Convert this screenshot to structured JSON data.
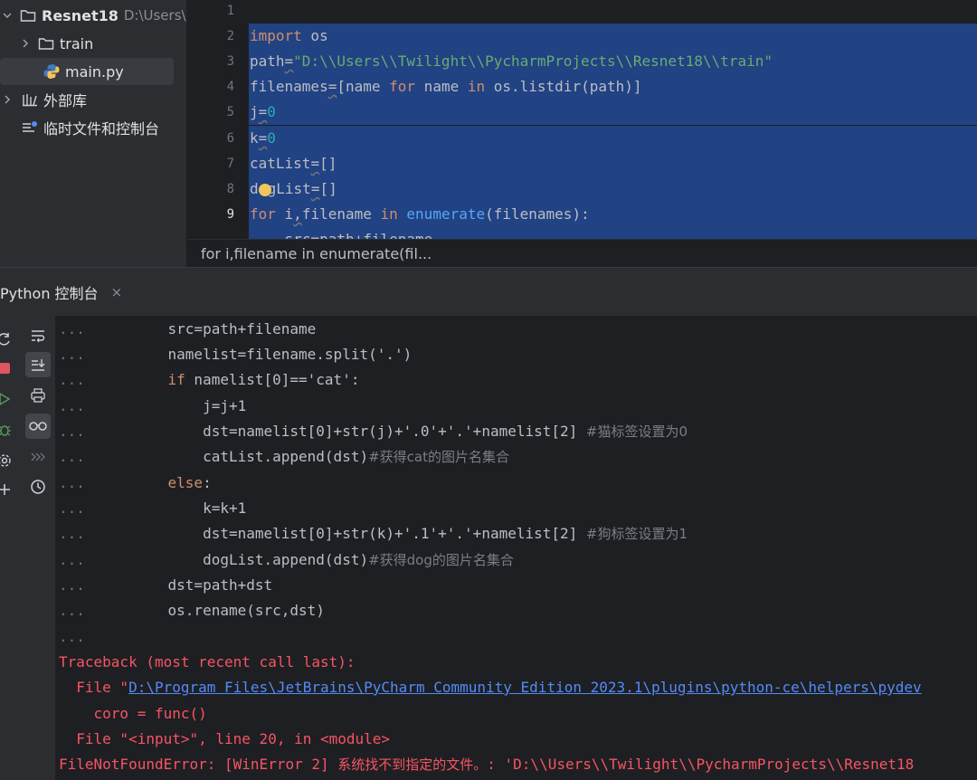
{
  "project_tree": {
    "root": {
      "name": "Resnet18",
      "path": "D:\\Users\\"
    },
    "items": [
      {
        "label": "train"
      },
      {
        "label": "main.py"
      },
      {
        "label": "外部库"
      },
      {
        "label": "临时文件和控制台"
      }
    ]
  },
  "editor": {
    "line_numbers": [
      "1",
      "2",
      "3",
      "4",
      "5",
      "6",
      "7",
      "8",
      "9"
    ],
    "current_line": "9",
    "lines": {
      "l2": {
        "kw_import": "import",
        "rest": " os"
      },
      "l3": {
        "name": "path",
        "eq": "=",
        "str": "\"D:\\\\Users\\\\Twilight\\\\PycharmProjects\\\\Resnet18\\\\train\""
      },
      "l4": {
        "name": "filenames",
        "eq": "=",
        "a": "[name ",
        "kw_for": "for",
        "b": " name ",
        "kw_in": "in",
        "c": " os.listdir(path)]"
      },
      "l5": {
        "name": "j",
        "eq": "=",
        "num": "0"
      },
      "l6": {
        "name": "k",
        "eq": "=",
        "num": "0"
      },
      "l7": {
        "name": "catList",
        "eq": "=",
        "rest": "[]"
      },
      "l8": {
        "a": "d",
        "b": "gList",
        "eq": "=",
        "rest": "[]"
      },
      "l9": {
        "kw_for": "for",
        "a": " i",
        "comma": ",",
        "b": "filename ",
        "kw_in": "in",
        "fn": " enumerate",
        "rest": "(filenames):"
      },
      "l10_partial": "    src=path+filename"
    }
  },
  "breadcrumb": {
    "text": "for i,filename in enumerate(fil..."
  },
  "console": {
    "tab_label": "Python 控制台",
    "tab_close": "×",
    "prompt": "...",
    "lines": [
      {
        "indent": "    ",
        "code": "src=path+filename"
      },
      {
        "indent": "    ",
        "code": "namelist=filename.split('.')"
      },
      {
        "indent": "    ",
        "kw": "if",
        "code": " namelist[0]=='cat':"
      },
      {
        "indent": "        ",
        "code": "j=j+1"
      },
      {
        "indent": "        ",
        "code": "dst=namelist[0]+str(j)+'.0'+'.'+namelist[2] ",
        "comment": "#猫标签设置为0"
      },
      {
        "indent": "        ",
        "code": "catList.append(dst)",
        "comment": "#获得cat的图片名集合"
      },
      {
        "indent": "    ",
        "kw": "else",
        "code": ":"
      },
      {
        "indent": "        ",
        "code": "k=k+1"
      },
      {
        "indent": "        ",
        "code": "dst=namelist[0]+str(k)+'.1'+'.'+namelist[2] ",
        "comment": "#狗标签设置为1"
      },
      {
        "indent": "        ",
        "code": "dogList.append(dst)",
        "comment": "#获得dog的图片名集合"
      },
      {
        "indent": "    ",
        "code": "dst=path+dst"
      },
      {
        "indent": "    ",
        "code": "os.rename(src,dst)"
      },
      {
        "indent": "",
        "code": ""
      }
    ],
    "traceback": {
      "header": "Traceback (most recent call last):",
      "file1_prefix": "  File \"",
      "file1_link": "D:\\Program Files\\JetBrains\\PyCharm Community Edition 2023.1\\plugins\\python-ce\\helpers\\pydev",
      "coro": "    coro = func()",
      "file2": "  File \"<input>\", line 20, in <module>",
      "error_prefix": "FileNotFoundError: [WinError 2] ",
      "error_cn": "系统找不到指定的文件。",
      "error_suffix": ": 'D:\\\\Users\\\\Twilight\\\\PycharmProjects\\\\Resnet18"
    }
  },
  "colors": {
    "background": "#1e1f22",
    "panel": "#2b2d30",
    "selection": "#214283",
    "keyword": "#cf8e6d",
    "string": "#6aab73",
    "number": "#2aacb8",
    "function": "#56a8f5",
    "error": "#f75464",
    "link": "#548af7"
  },
  "icons": [
    "chevron-down-icon",
    "chevron-right-icon",
    "folder-icon",
    "python-file-icon",
    "library-icon",
    "scratches-icon",
    "rerun-icon",
    "stop-icon",
    "run-icon",
    "debug-icon",
    "settings-icon",
    "add-icon",
    "soft-wrap-icon",
    "scroll-to-end-icon",
    "print-icon",
    "show-variables-icon",
    "more-icon",
    "history-icon",
    "lightbulb-icon"
  ]
}
